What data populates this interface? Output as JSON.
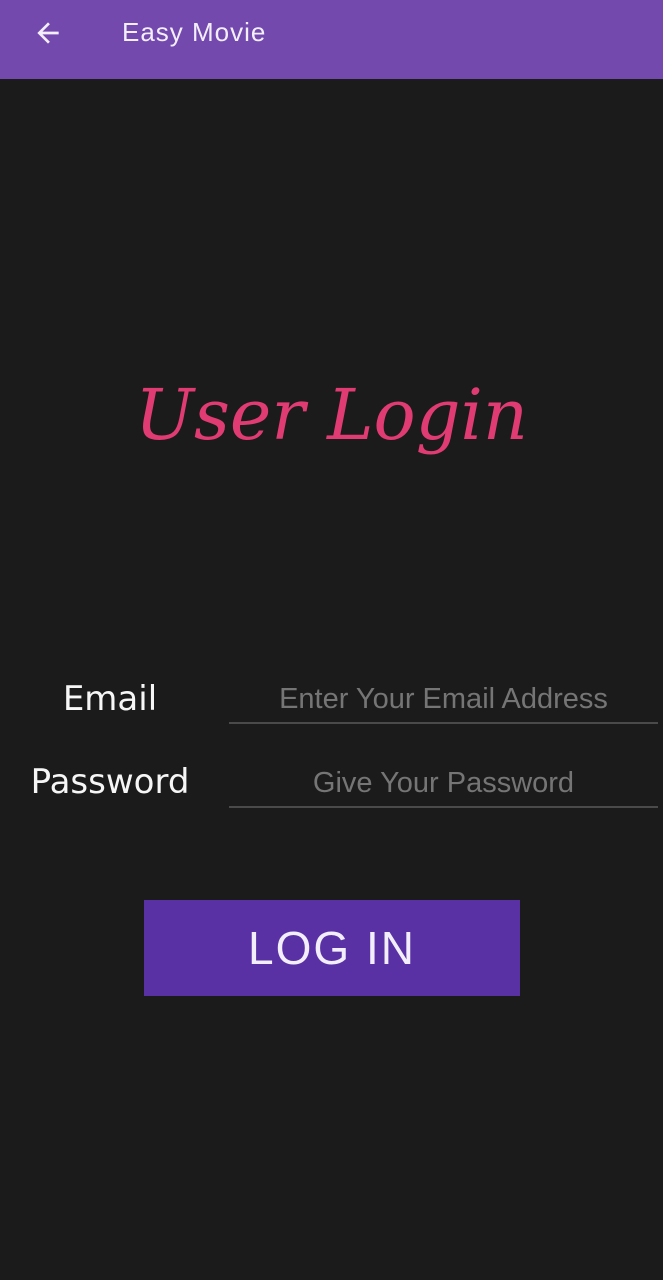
{
  "appbar": {
    "back_icon": "arrow-left-icon",
    "title": "Easy Movie",
    "background_color": "#7349ad"
  },
  "main": {
    "heading": "User Login",
    "heading_color": "#e03b72",
    "email": {
      "label": "Email",
      "placeholder": "Enter Your Email Address",
      "value": ""
    },
    "password": {
      "label": "Password",
      "placeholder": "Give Your Password",
      "value": ""
    },
    "login_button": {
      "label": "LOG IN",
      "background_color": "#5a31a5"
    }
  },
  "screen": {
    "background_color": "#1b1b1b"
  }
}
